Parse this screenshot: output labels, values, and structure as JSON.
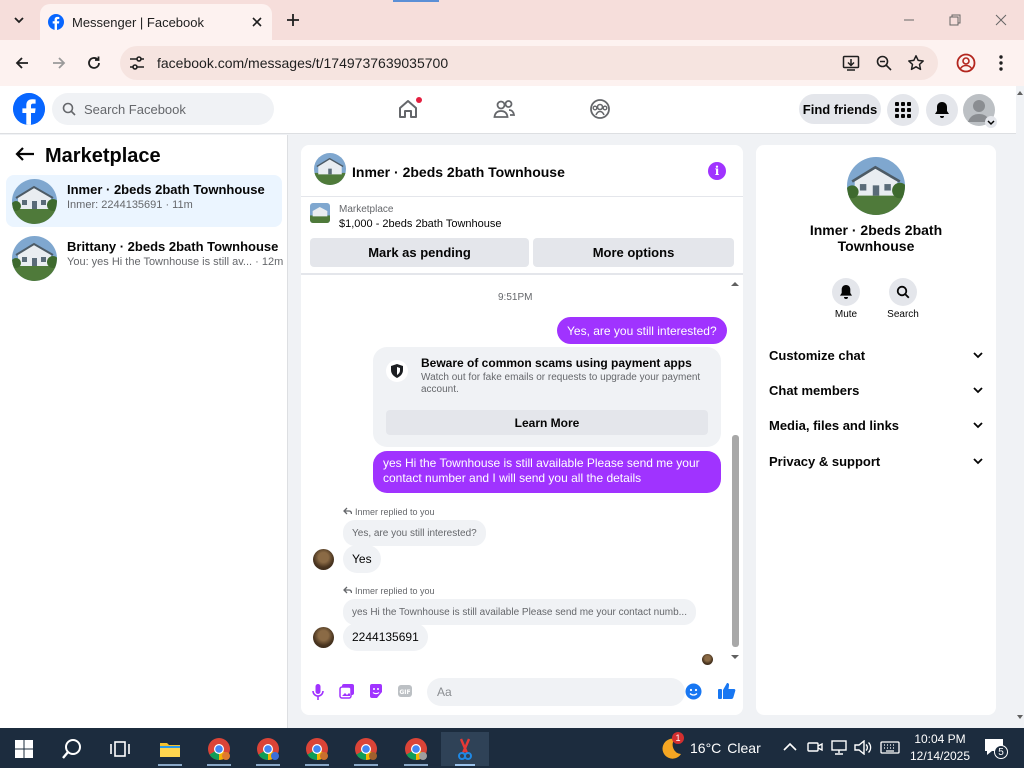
{
  "browser": {
    "tab_title": "Messenger | Facebook",
    "url": "facebook.com/messages/t/1749737639035700"
  },
  "fb": {
    "search_placeholder": "Search Facebook",
    "find_friends": "Find friends"
  },
  "left": {
    "title": "Marketplace",
    "conversations": [
      {
        "name": "Inmer · 2beds 2bath Townhouse",
        "preview": "Inmer: 2244135691 · 11m"
      },
      {
        "name": "Brittany · 2beds 2bath Townhouse",
        "preview": "You: yes Hi the Townhouse is still av... · 12m"
      }
    ]
  },
  "chat": {
    "title": "Inmer · 2beds 2bath Townhouse",
    "marketplace_label": "Marketplace",
    "listing": "$1,000 - 2beds 2bath Townhouse",
    "mark_pending": "Mark as pending",
    "more_options": "More options",
    "time": "9:51PM",
    "msg1": "Yes, are you still interested?",
    "scam_title": "Beware of common scams using payment apps",
    "scam_text": "Watch out for fake emails or requests to upgrade your payment account.",
    "learn_more": "Learn More",
    "msg2": "yes Hi the Townhouse is still available Please send me your contact number and I will send you all the details",
    "reply1_label": "Inmer replied to you",
    "reply1_quote": "Yes, are you still interested?",
    "reply1_text": "Yes",
    "reply2_label": "Inmer replied to you",
    "reply2_quote": "yes Hi the Townhouse is still available Please send me your contact numb...",
    "reply2_text": "2244135691",
    "composer_placeholder": "Aa"
  },
  "right": {
    "name": "Inmer · 2beds 2bath Townhouse",
    "mute": "Mute",
    "search": "Search",
    "rows": [
      "Customize chat",
      "Chat members",
      "Media, files and links",
      "Privacy & support"
    ]
  },
  "taskbar": {
    "weather_temp": "16°C",
    "weather_desc": "Clear",
    "weather_badge": "1",
    "time": "10:04 PM",
    "date": "12/14/2025",
    "notif_count": "5"
  },
  "colors": {
    "accent": "#a033ff",
    "fb_blue": "#0866ff",
    "tab_strip": "#f6dedb"
  }
}
